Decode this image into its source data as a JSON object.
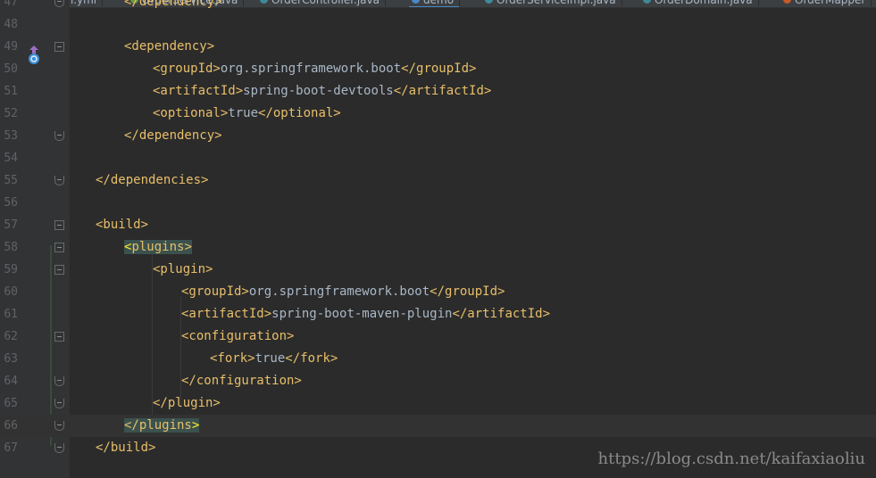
{
  "tabs": [
    {
      "label": "application.yml",
      "icon": "yml-file-icon",
      "color": "#8b8b8b"
    },
    {
      "label": "OrderService.java",
      "icon": "java-interface-icon",
      "color": "#6a9a3e"
    },
    {
      "label": "OrderController.java",
      "icon": "java-class-icon",
      "color": "#3f8a9a"
    },
    {
      "label": "demo",
      "icon": "maven-pom-icon",
      "color": "#4a88c7",
      "active": true
    },
    {
      "label": "OrderServiceImpl.java",
      "icon": "java-class-icon",
      "color": "#3f8a9a"
    },
    {
      "label": "OrderDomain.java",
      "icon": "java-class-icon",
      "color": "#3f8a9a"
    },
    {
      "label": "OrderMapper",
      "icon": "mybatis-mapper-icon",
      "color": "#c75a2a"
    }
  ],
  "lines": [
    {
      "n": "47",
      "indent": 2,
      "parts": [
        [
          "tag",
          "</dependency>"
        ]
      ],
      "fold": "end"
    },
    {
      "n": "48",
      "indent": 0,
      "parts": []
    },
    {
      "n": "49",
      "indent": 2,
      "parts": [
        [
          "tag",
          "<dependency>"
        ]
      ],
      "fold": "open",
      "marker": "implementation-marker-icon"
    },
    {
      "n": "50",
      "indent": 3,
      "parts": [
        [
          "tag",
          "<groupId>"
        ],
        [
          "txt",
          "org.springframework.boot"
        ],
        [
          "tag",
          "</groupId>"
        ]
      ]
    },
    {
      "n": "51",
      "indent": 3,
      "parts": [
        [
          "tag",
          "<artifactId>"
        ],
        [
          "txt",
          "spring-boot-devtools"
        ],
        [
          "tag",
          "</artifactId>"
        ]
      ]
    },
    {
      "n": "52",
      "indent": 3,
      "parts": [
        [
          "tag",
          "<optional>"
        ],
        [
          "txt",
          "true"
        ],
        [
          "tag",
          "</optional>"
        ]
      ]
    },
    {
      "n": "53",
      "indent": 2,
      "parts": [
        [
          "tag",
          "</dependency>"
        ]
      ],
      "fold": "end"
    },
    {
      "n": "54",
      "indent": 0,
      "parts": []
    },
    {
      "n": "55",
      "indent": 1,
      "parts": [
        [
          "tag",
          "</dependencies>"
        ]
      ],
      "fold": "end"
    },
    {
      "n": "56",
      "indent": 0,
      "parts": []
    },
    {
      "n": "57",
      "indent": 1,
      "parts": [
        [
          "tag",
          "<build>"
        ]
      ],
      "fold": "open"
    },
    {
      "n": "58",
      "indent": 2,
      "parts": [
        [
          "hl",
          "<"
        ],
        [
          "hltag",
          "plugins>"
        ]
      ],
      "fold": "open"
    },
    {
      "n": "59",
      "indent": 3,
      "parts": [
        [
          "tag",
          "<plugin>"
        ]
      ],
      "fold": "open"
    },
    {
      "n": "60",
      "indent": 4,
      "parts": [
        [
          "tag",
          "<groupId>"
        ],
        [
          "txt",
          "org.springframework.boot"
        ],
        [
          "tag",
          "</groupId>"
        ]
      ]
    },
    {
      "n": "61",
      "indent": 4,
      "parts": [
        [
          "tag",
          "<artifactId>"
        ],
        [
          "txt",
          "spring-boot-maven-plugin"
        ],
        [
          "tag",
          "</artifactId>"
        ]
      ]
    },
    {
      "n": "62",
      "indent": 4,
      "parts": [
        [
          "tag",
          "<configuration>"
        ]
      ],
      "fold": "open"
    },
    {
      "n": "63",
      "indent": 5,
      "parts": [
        [
          "tag",
          "<fork>"
        ],
        [
          "txt",
          "true"
        ],
        [
          "tag",
          "</fork>"
        ]
      ]
    },
    {
      "n": "64",
      "indent": 4,
      "parts": [
        [
          "tag",
          "</configuration>"
        ]
      ],
      "fold": "end"
    },
    {
      "n": "65",
      "indent": 3,
      "parts": [
        [
          "tag",
          "</plugin>"
        ]
      ],
      "fold": "end"
    },
    {
      "n": "66",
      "indent": 2,
      "parts": [
        [
          "hltag",
          "</plugins"
        ],
        [
          "hl",
          ">"
        ]
      ],
      "fold": "end",
      "current": true
    },
    {
      "n": "67",
      "indent": 1,
      "parts": [
        [
          "tag",
          "</build>"
        ]
      ],
      "fold": "end"
    }
  ],
  "watermark": "https://blog.csdn.net/kaifaxiaoliu",
  "colors": {
    "background": "#2b2b2b",
    "gutter": "#313335",
    "tag": "#e8bf6a",
    "text": "#a9b7c6",
    "line_number": "#606366",
    "brace_match_bg": "#3b514d",
    "brace_match_fg": "#ffef28"
  }
}
